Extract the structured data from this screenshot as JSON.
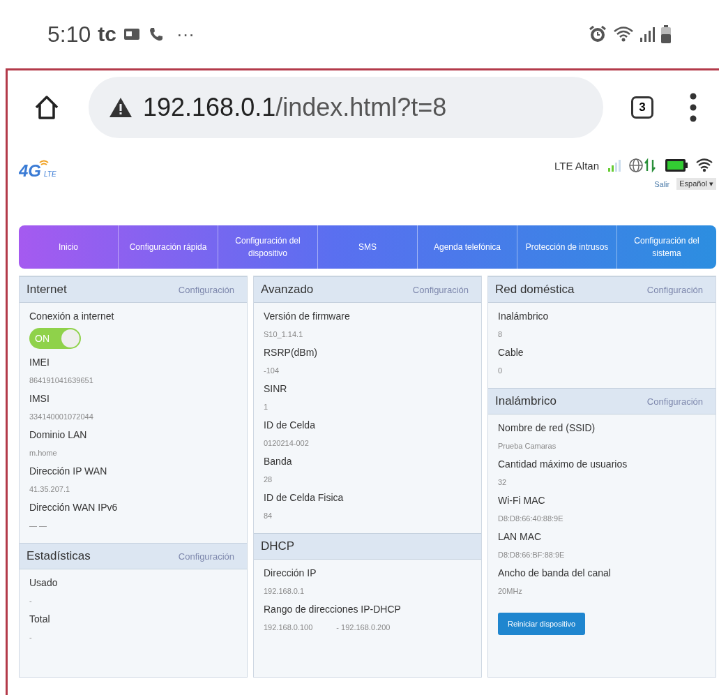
{
  "status_bar": {
    "time": "5:10",
    "carrier": "tc",
    "more": "···"
  },
  "browser": {
    "url_host": "192.168.0.1",
    "url_path": "/index.html?t=8",
    "tab_count": "3"
  },
  "header": {
    "logo_main": "4G",
    "logo_sub": "LTE",
    "network": "LTE Altan",
    "logout": "Salir",
    "language": "Español ▾"
  },
  "nav": {
    "items": [
      {
        "label": "Inicio"
      },
      {
        "label": "Configuración rápida"
      },
      {
        "label": "Configuración del dispositivo"
      },
      {
        "label": "SMS"
      },
      {
        "label": "Agenda telefónica"
      },
      {
        "label": "Protección de intrusos"
      },
      {
        "label": "Configuración del sistema"
      }
    ]
  },
  "columns": [
    {
      "sections": [
        {
          "title": "Internet",
          "link": "Configuración",
          "fields": [
            {
              "kind": "toggle",
              "label": "Conexión a internet",
              "on": true,
              "text": "ON"
            },
            {
              "kind": "text",
              "label": "IMEI",
              "value": "864191041639651"
            },
            {
              "kind": "text",
              "label": "IMSI",
              "value": "334140001072044"
            },
            {
              "kind": "text",
              "label": "Dominio LAN",
              "value": "m.home"
            },
            {
              "kind": "text",
              "label": "Dirección IP WAN",
              "value": "41.35.207.1"
            },
            {
              "kind": "text",
              "label": "Dirección WAN IPv6",
              "value": "— —"
            }
          ]
        },
        {
          "title": "Estadísticas",
          "link": "Configuración",
          "fields": [
            {
              "kind": "text",
              "label": "Usado",
              "value": "-"
            },
            {
              "kind": "text",
              "label": "Total",
              "value": "-"
            }
          ]
        }
      ]
    },
    {
      "sections": [
        {
          "title": "Avanzado",
          "link": "Configuración",
          "fields": [
            {
              "kind": "text",
              "label": "Versión de firmware",
              "value": "S10_1.14.1"
            },
            {
              "kind": "text",
              "label": "RSRP(dBm)",
              "value": "-104"
            },
            {
              "kind": "text",
              "label": "SINR",
              "value": "1"
            },
            {
              "kind": "text",
              "label": "ID de Celda",
              "value": "0120214-002"
            },
            {
              "kind": "text",
              "label": "Banda",
              "value": "28"
            },
            {
              "kind": "text",
              "label": "ID de Celda Fisica",
              "value": "84"
            }
          ]
        },
        {
          "title": "DHCP",
          "fields": [
            {
              "kind": "text",
              "label": "Dirección IP",
              "value": "192.168.0.1"
            },
            {
              "kind": "range",
              "label": "Rango de direcciones IP-DHCP",
              "from": "192.168.0.100",
              "separator": "-",
              "to": "192.168.0.200"
            }
          ]
        }
      ]
    },
    {
      "sections": [
        {
          "title": "Red doméstica",
          "link": "Configuración",
          "fields": [
            {
              "kind": "text",
              "label": "Inalámbrico",
              "value": "8"
            },
            {
              "kind": "text",
              "label": "Cable",
              "value": "0"
            }
          ]
        },
        {
          "title": "Inalámbrico",
          "link": "Configuración",
          "fields": [
            {
              "kind": "text",
              "label": "Nombre de red (SSID)",
              "value": "Prueba Camaras"
            },
            {
              "kind": "text",
              "label": "Cantidad máximo de usuarios",
              "value": "32"
            },
            {
              "kind": "text",
              "label": "Wi-Fi MAC",
              "value": "D8:D8:66:40:88:9E"
            },
            {
              "kind": "text",
              "label": "LAN MAC",
              "value": "D8:D8:66:BF:88:9E"
            },
            {
              "kind": "text",
              "label": "Ancho de banda del canal",
              "value": "20MHz"
            }
          ]
        }
      ],
      "button": "Reiniciar dispositivo"
    }
  ]
}
